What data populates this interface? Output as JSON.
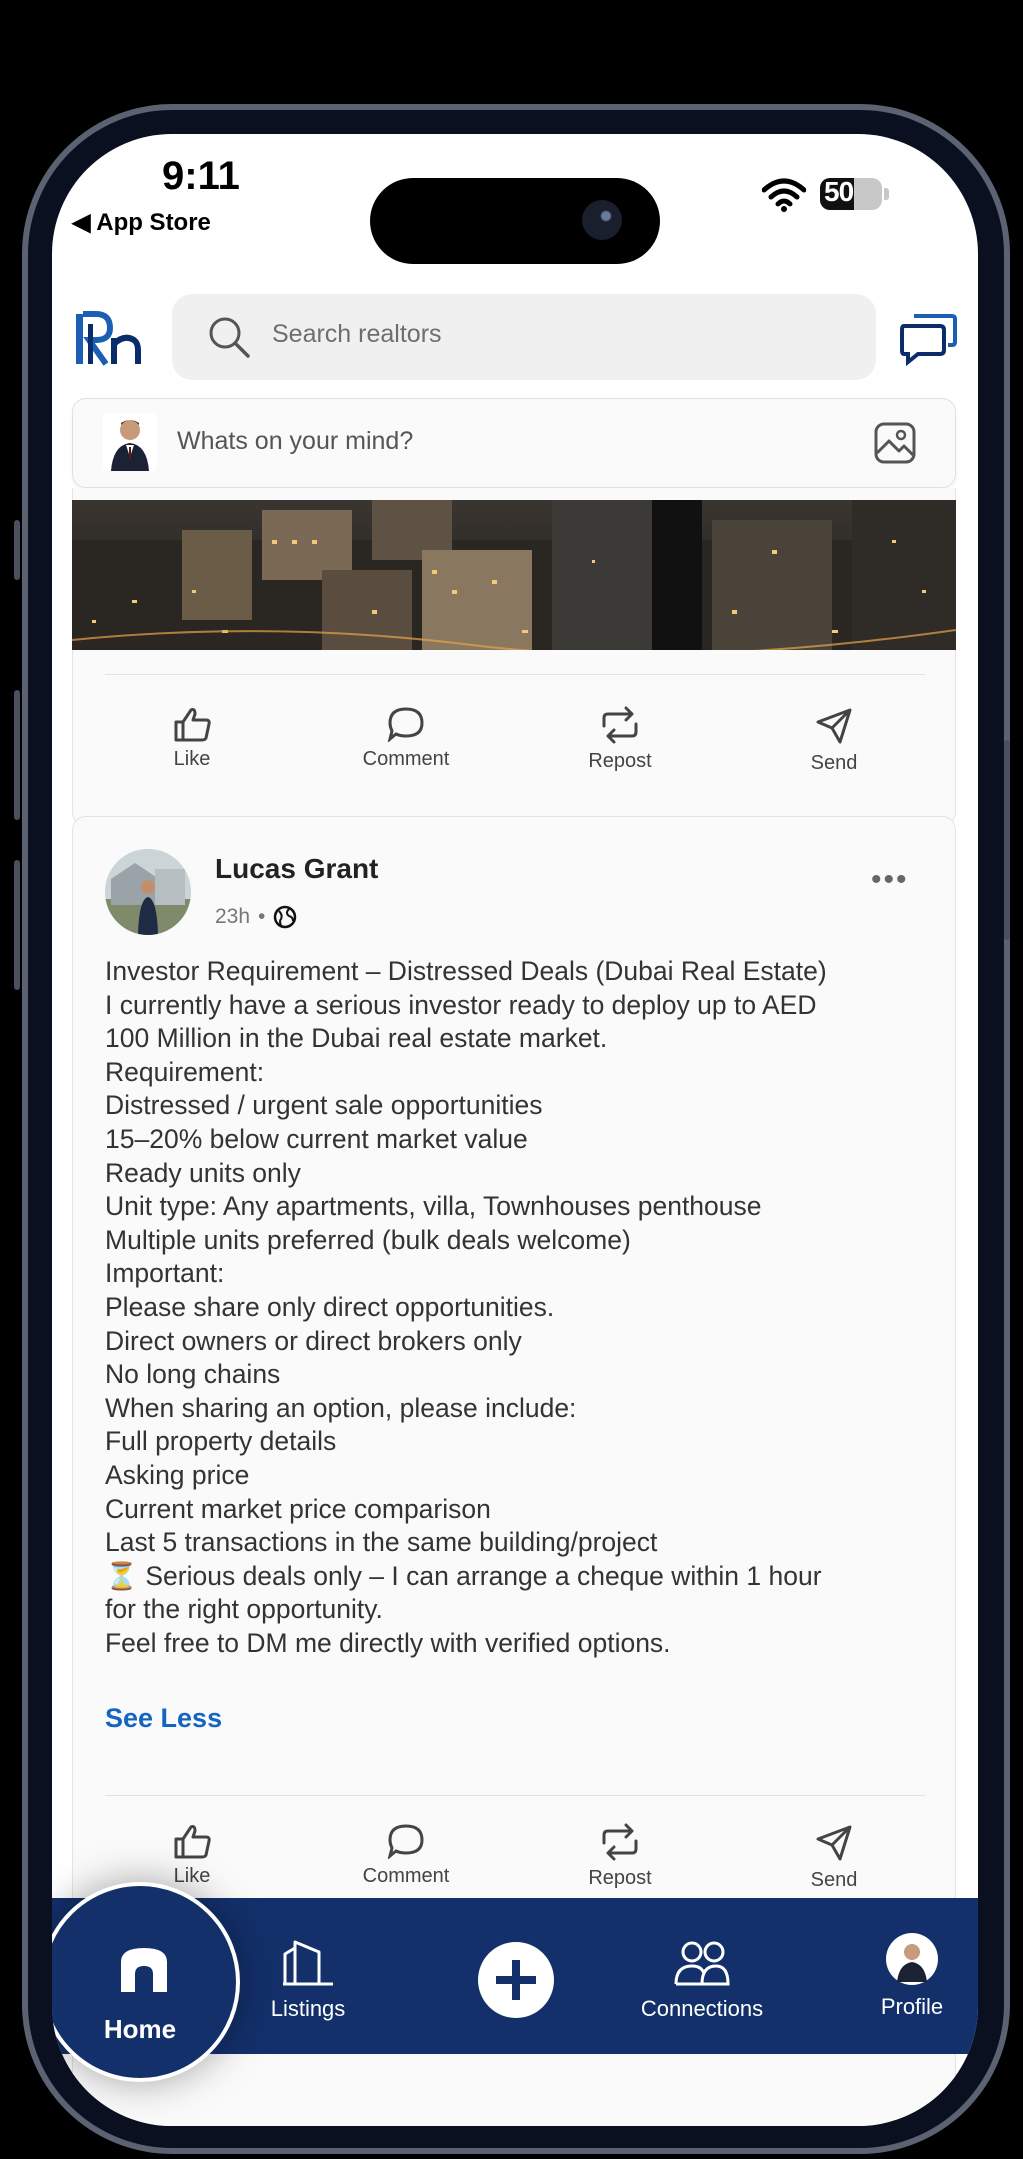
{
  "status_bar": {
    "time": "9:11",
    "back_label": "◀ App Store",
    "battery": "50"
  },
  "header": {
    "logo_text": "Rn",
    "search_placeholder": "Search realtors"
  },
  "composer": {
    "placeholder": "Whats on your mind?"
  },
  "post_actions": {
    "like": "Like",
    "comment": "Comment",
    "repost": "Repost",
    "send": "Send"
  },
  "post": {
    "author": "Lucas Grant",
    "time": "23h",
    "separator": "•",
    "lines": [
      "Investor Requirement – Distressed Deals (Dubai Real Estate)",
      "I currently have a serious investor ready to deploy up to AED",
      "100 Million in the Dubai real estate market.",
      "Requirement:",
      "Distressed / urgent sale opportunities",
      "15–20% below current market value",
      "Ready units only",
      "Unit type: Any apartments, villa, Townhouses penthouse",
      "Multiple units preferred (bulk deals welcome)",
      "Important:",
      "Please share only direct opportunities.",
      "Direct owners or direct brokers only",
      "No long chains",
      "When sharing an option, please include:",
      "Full property details",
      "Asking price",
      "Current market price comparison",
      "Last 5 transactions in the same building/project",
      "⏳ Serious deals only – I can arrange a cheque within 1 hour",
      "for the right opportunity.",
      "Feel free to DM me directly with verified options."
    ],
    "see_less": "See Less"
  },
  "bottom_nav": {
    "home": "Home",
    "listings": "Listings",
    "connections": "Connections",
    "profile": "Profile"
  },
  "colors": {
    "nav_bg": "#13306b",
    "link": "#1565c0"
  }
}
